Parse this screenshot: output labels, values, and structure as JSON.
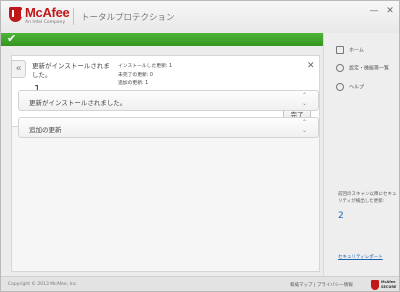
{
  "app": {
    "brand": "McAfee",
    "brand_sub": "An Intel Company",
    "title": "トータルプロテクション",
    "minimize": "—",
    "close": "✕"
  },
  "status": {
    "icon": "check-icon",
    "color": "#3fa82c"
  },
  "card": {
    "back": "«",
    "title": "更新がインストールされました。",
    "count": "1",
    "details": [
      "インストールした更新: 1",
      "未完了の更新: 0",
      "追加の更新: 1"
    ],
    "close": "✕",
    "done_label": "完了"
  },
  "accordions": [
    {
      "label": "更新がインストールされました。"
    },
    {
      "label": "追加の更新"
    }
  ],
  "sidebar": {
    "items": [
      {
        "label": "ホーム",
        "icon": "home-icon"
      },
      {
        "label": "設定・機能等一覧",
        "icon": "settings-icon"
      },
      {
        "label": "ヘルプ",
        "icon": "help-icon"
      }
    ],
    "scan_text": "前回のスキャン以降にセキュリティが検出した更新:",
    "scan_count": "2",
    "security_link": "セキュリティレポート"
  },
  "footer": {
    "copyright": "Copyright © 2013 McAfee, Inc.",
    "links": "脅威マップ | プライバシー情報",
    "badge_line1": "McAfee",
    "badge_line2": "SECURE"
  }
}
